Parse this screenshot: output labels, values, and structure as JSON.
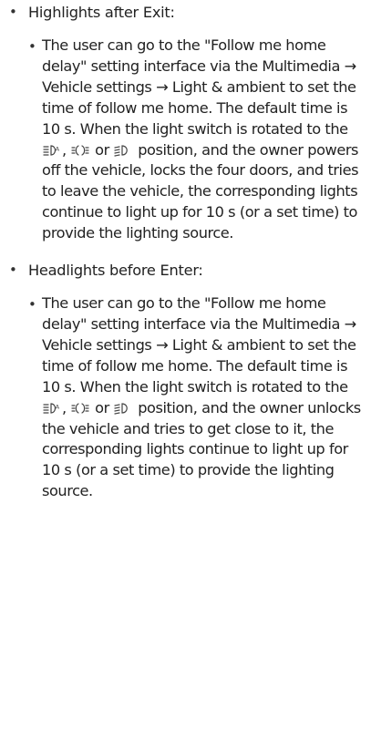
{
  "items": [
    {
      "bullet": "•",
      "label": "Highlights after Exit:",
      "sub": {
        "bullet": "•",
        "text_a": "The user can go to the \"Follow me home delay\" setting interface via the Multimedia → Vehicle settings → Light & ambient to set the time of follow me home. The default time is 10 s. When the light switch is rotated to the",
        "sep_1": ",",
        "sep_2": "or",
        "text_b": "position, and the owner powers off the vehicle, locks the four doors, and tries to leave the vehicle, the corresponding lights continue to light up for 10 s (or a set time) to provide the lighting source."
      }
    },
    {
      "bullet": "•",
      "label": "Headlights before Enter:",
      "sub": {
        "bullet": "•",
        "text_a": "The user can go to the \"Follow me home delay\" setting interface via the Multimedia → Vehicle settings → Light & ambient to set the time of follow me home. The default time is 10 s. When the light switch is rotated to the",
        "sep_1": ",",
        "sep_2": "or",
        "text_b": "position, and the owner unlocks the vehicle and tries to get close to it, the corresponding lights continue to light up for 10 s (or a set time) to provide the lighting source."
      }
    }
  ],
  "icons": [
    "auto-light-icon",
    "position-light-icon",
    "low-beam-icon"
  ]
}
